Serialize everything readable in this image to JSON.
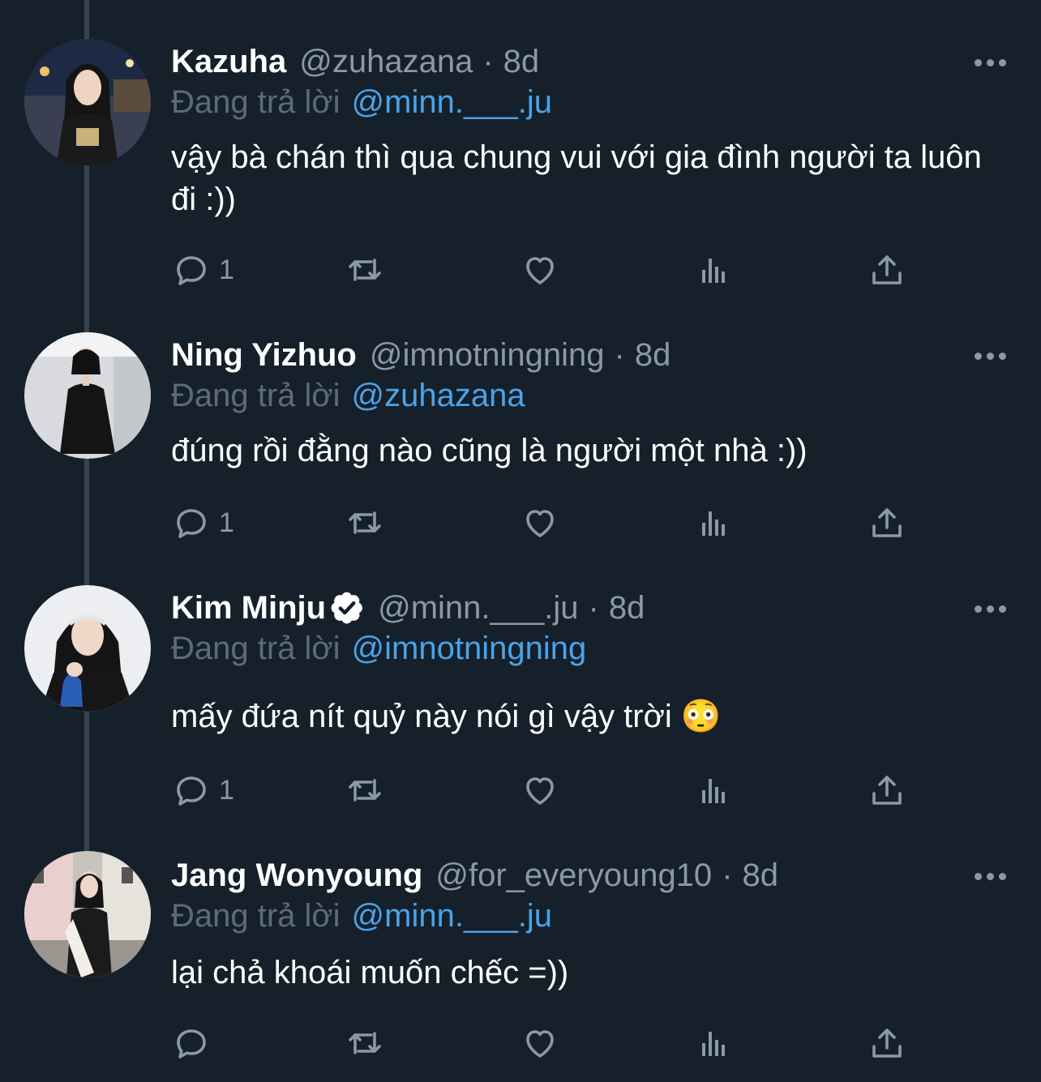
{
  "replying_label": "Đang trả lời",
  "tweets": [
    {
      "name": "Kazuha",
      "handle": "@zuhazana",
      "separator": "·",
      "time": "8d",
      "verified": false,
      "reply_to": "@minn.___.ju",
      "text": "vậy bà chán thì qua chung vui với gia đình người ta luôn đi :))",
      "reply_count": "1"
    },
    {
      "name": "Ning Yizhuo",
      "handle": "@imnotningning",
      "separator": "·",
      "time": "8d",
      "verified": false,
      "reply_to": "@zuhazana",
      "text": "đúng rồi đằng nào cũng là người một nhà :))",
      "reply_count": "1"
    },
    {
      "name": "Kim Minju",
      "handle": "@minn.___.ju",
      "separator": "·",
      "time": "8d",
      "verified": true,
      "reply_to": "@imnotningning",
      "text": "mấy đứa nít quỷ này nói gì vậy trời 😳",
      "reply_count": "1"
    },
    {
      "name": "Jang Wonyoung",
      "handle": "@for_everyoung10",
      "separator": "·",
      "time": "8d",
      "verified": false,
      "reply_to": "@minn.___.ju",
      "text": "lại chả khoái muốn chếc =))",
      "reply_count": ""
    }
  ],
  "icons": {
    "reply": "reply-icon",
    "retweet": "retweet-icon",
    "like": "heart-icon",
    "views": "views-icon",
    "share": "share-icon",
    "more": "more-icon",
    "verified": "verified-badge-icon"
  },
  "colors": {
    "background": "#15202b",
    "mention": "#4aa3e8",
    "secondary_text": "#8b98a5",
    "thread_line": "#38444d"
  }
}
